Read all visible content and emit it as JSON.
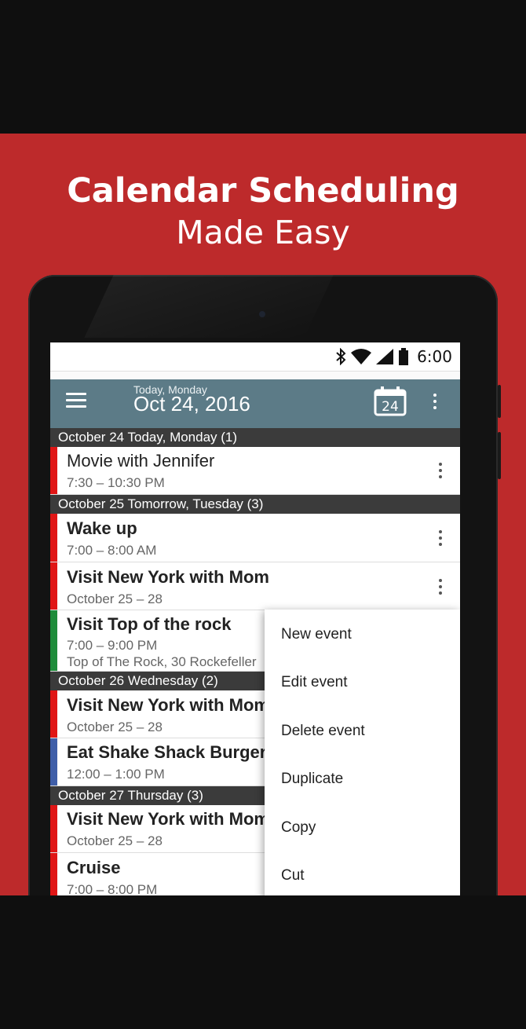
{
  "promo": {
    "title_line1": "Calendar Scheduling",
    "title_line2": "Made Easy"
  },
  "status_bar": {
    "time": "6:00",
    "icons": [
      "bluetooth-icon",
      "wifi-icon",
      "cell-signal-icon",
      "battery-icon"
    ]
  },
  "toolbar": {
    "subtitle": "Today, Monday",
    "date": "Oct 24, 2016",
    "today_icon_day": "24",
    "icons": [
      "menu-icon",
      "calendar-today-icon",
      "more-vert-icon"
    ]
  },
  "days": [
    {
      "header": "October 24 Today, Monday (1)",
      "events": [
        {
          "title": "Movie with Jennifer",
          "time": "7:30 – 10:30 PM",
          "color": "#e01616"
        }
      ]
    },
    {
      "header": "October 25 Tomorrow, Tuesday (3)",
      "events": [
        {
          "title": "Wake up",
          "time": "7:00 – 8:00 AM",
          "color": "#e01616"
        },
        {
          "title": "Visit New York with Mom",
          "time": "October 25 – 28",
          "color": "#e01616"
        },
        {
          "title": "Visit Top of the rock",
          "time": "7:00 – 9:00 PM",
          "location": "Top of The Rock, 30 Rockefeller",
          "color": "#1e8c3a"
        }
      ]
    },
    {
      "header": "October 26 Wednesday (2)",
      "events": [
        {
          "title": "Visit New York with Mom",
          "time": "October 25 – 28",
          "color": "#e01616"
        },
        {
          "title": "Eat Shake Shack Burger",
          "time": "12:00 – 1:00 PM",
          "color": "#3f5ea8"
        }
      ]
    },
    {
      "header": "October 27 Thursday (3)",
      "events": [
        {
          "title": "Visit New York with Mom",
          "time": "October 25 – 28",
          "color": "#e01616"
        },
        {
          "title": "Cruise",
          "time": "7:00 – 8:00 PM",
          "color": "#e01616"
        }
      ]
    }
  ],
  "context_menu": {
    "items": [
      "New event",
      "Edit event",
      "Delete event",
      "Duplicate",
      "Copy",
      "Cut"
    ]
  },
  "colors": {
    "banner": "#bd2a2b",
    "toolbar": "#5c7b87",
    "day_header": "#3b3b3b"
  }
}
